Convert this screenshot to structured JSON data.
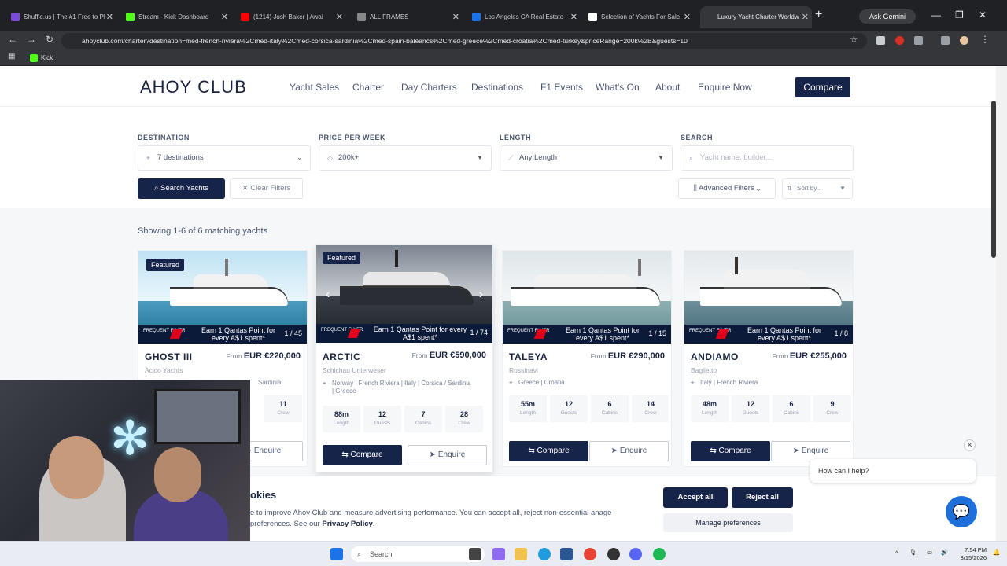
{
  "browser": {
    "tabs": [
      {
        "title": "Shuffle.us | The #1 Free to Pl",
        "color": "#7a4bd6"
      },
      {
        "title": "Stream - Kick Dashboard",
        "color": "#53fc18"
      },
      {
        "title": "(1214) Josh Baker | Awai",
        "color": "#ff0000"
      },
      {
        "title": "ALL FRAMES",
        "color": "#888888"
      },
      {
        "title": "Los Angeles CA Real Estate",
        "color": "#1a73e8"
      },
      {
        "title": "Selection of Yachts For Sale",
        "color": "#ffffff"
      },
      {
        "title": "Luxury Yacht Charter Worldw",
        "color": "#1a2340"
      }
    ],
    "url": "ahoyclub.com/charter?destination=med-french-riviera%2Cmed-italy%2Cmed-corsica-sardinia%2Cmed-spain-balearics%2Cmed-greece%2Cmed-croatia%2Cmed-turkey&priceRange=200k%2B&guests=10",
    "gemini_label": "Ask Gemini",
    "bookmark": "Kick"
  },
  "site": {
    "logo": "AHOY CLUB",
    "nav": [
      "Yacht Sales",
      "Charter",
      "Day Charters",
      "Destinations",
      "F1 Events",
      "What's On",
      "About",
      "Enquire Now"
    ],
    "compare": "Compare"
  },
  "filters": {
    "destination_label": "DESTINATION",
    "destination_value": "7 destinations",
    "price_label": "PRICE PER WEEK",
    "price_value": "200k+",
    "length_label": "LENGTH",
    "length_value": "Any Length",
    "search_label": "SEARCH",
    "search_placeholder": "Yacht name, builder...",
    "search_button": "Search Yachts",
    "clear_button": "Clear Filters",
    "advanced": "Advanced Filters",
    "sort": "Sort by..."
  },
  "results": {
    "showing": "Showing 1-6 of 6 matching yachts",
    "qantas_text": "Earn 1 Qantas Point for every A$1 spent*",
    "ff_label": "FREQUENT FLYER",
    "featured_label": "Featured",
    "from_label": "From",
    "compare_label": "Compare",
    "enquire_label": "Enquire",
    "cards": [
      {
        "name": "GHOST III",
        "price": "EUR €220,000",
        "builder": "Acico Yachts",
        "location": "Sardinia",
        "count": "1 / 45",
        "featured": true,
        "stats": [
          {
            "v": "11",
            "l": "Crew"
          }
        ]
      },
      {
        "name": "ARCTIC",
        "price": "EUR €590,000",
        "builder": "Schichau Unterweser",
        "location": "Norway | French Riviera | Italy | Corsica / Sardinia | Greece",
        "count": "1 / 74",
        "featured": true,
        "stats": [
          {
            "v": "88m",
            "l": "Length"
          },
          {
            "v": "12",
            "l": "Guests"
          },
          {
            "v": "7",
            "l": "Cabins"
          },
          {
            "v": "28",
            "l": "Crew"
          }
        ]
      },
      {
        "name": "TALEYA",
        "price": "EUR €290,000",
        "builder": "Rossinavi",
        "location": "Greece | Croatia",
        "count": "1 / 15",
        "featured": false,
        "stats": [
          {
            "v": "55m",
            "l": "Length"
          },
          {
            "v": "12",
            "l": "Guests"
          },
          {
            "v": "6",
            "l": "Cabins"
          },
          {
            "v": "14",
            "l": "Crew"
          }
        ]
      },
      {
        "name": "ANDIAMO",
        "price": "EUR €255,000",
        "builder": "Baglietto",
        "location": "Italy | French Riviera",
        "count": "1 / 8",
        "featured": false,
        "stats": [
          {
            "v": "48m",
            "l": "Length"
          },
          {
            "v": "12",
            "l": "Guests"
          },
          {
            "v": "6",
            "l": "Cabins"
          },
          {
            "v": "9",
            "l": "Crew"
          }
        ]
      }
    ]
  },
  "cookie": {
    "title": "okies",
    "text": "e to improve Ahoy Club and measure advertising performance. You can accept all, reject non-essential anage preferences. See our",
    "policy": "Privacy Policy",
    "accept": "Accept all",
    "reject": "Reject all",
    "manage": "Manage preferences"
  },
  "chat": {
    "prompt": "How can I help?"
  },
  "taskbar": {
    "search": "Search",
    "time": "7:54 PM",
    "date": "8/15/2026"
  }
}
